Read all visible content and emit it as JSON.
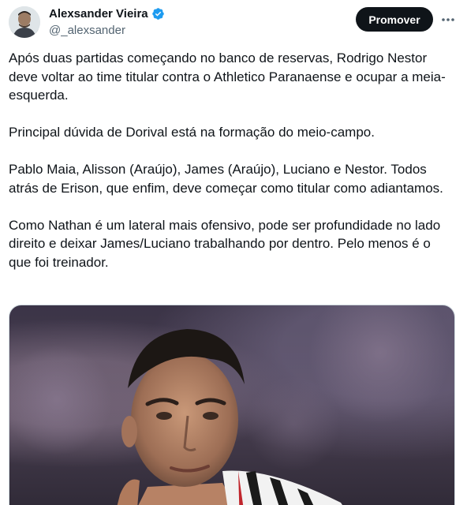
{
  "author": {
    "display_name": "Alexsander Vieira",
    "handle": "@_alexsander",
    "verified": true
  },
  "actions": {
    "promote_label": "Promover",
    "more_icon": "more-horizontal-icon"
  },
  "tweet": {
    "paragraphs": [
      "Após duas partidas começando no banco de reservas, Rodrigo Nestor deve voltar ao time titular contra o Athletico Paranaense e ocupar a meia-esquerda.",
      "Principal dúvida de Dorival está na formação do meio-campo.",
      "Pablo Maia, Alisson (Araújo), James (Araújo), Luciano e Nestor. Todos atrás de Erison, que enfim, deve começar como titular como adiantamos.",
      "Como Nathan é um lateral mais ofensivo, pode ser profundidade no lado direito e deixar James/Luciano trabalhando por dentro. Pelo menos é o que foi treinador."
    ]
  },
  "colors": {
    "text_primary": "#0f1419",
    "text_secondary": "#536471",
    "verified_blue": "#1d9bf0",
    "button_bg": "#0f1419"
  }
}
